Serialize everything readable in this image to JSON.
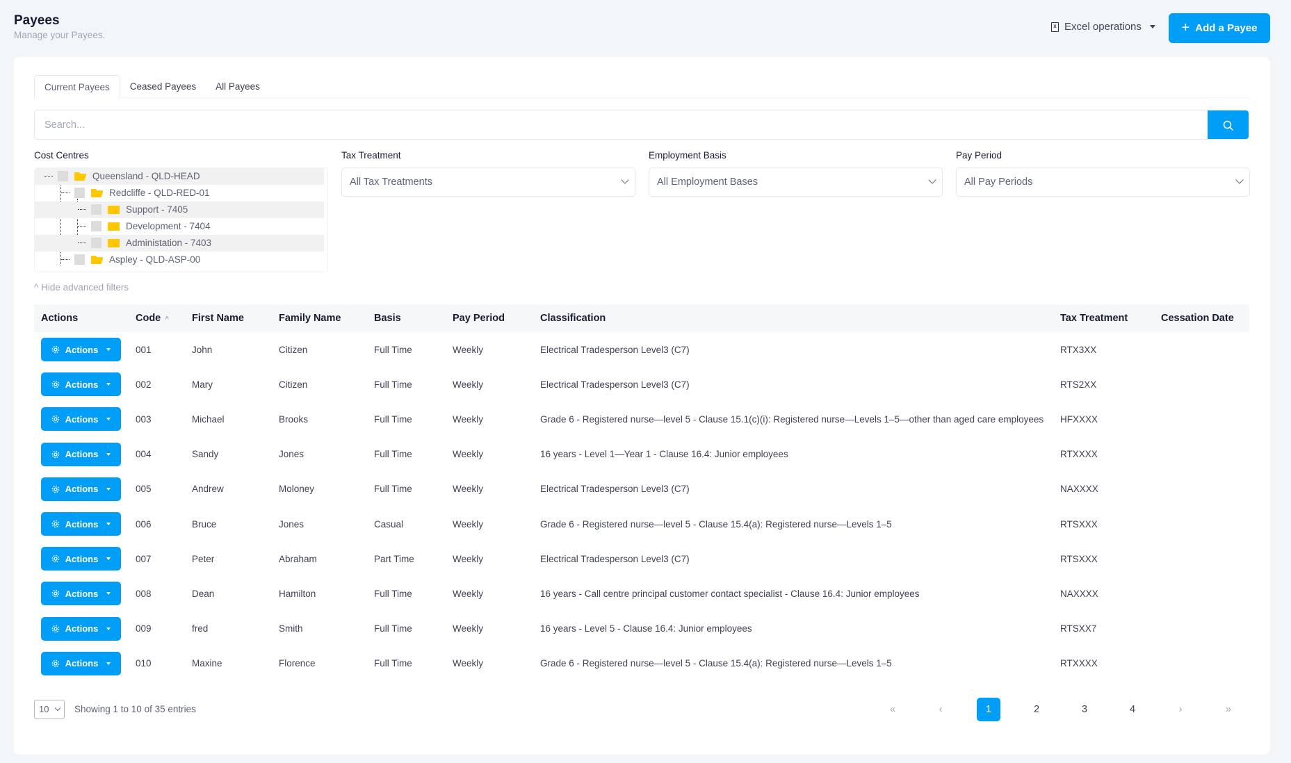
{
  "header": {
    "title": "Payees",
    "subtitle": "Manage your Payees.",
    "excel_label": "Excel operations",
    "add_label": "Add a Payee"
  },
  "tabs": [
    {
      "label": "Current Payees"
    },
    {
      "label": "Ceased Payees"
    },
    {
      "label": "All Payees"
    }
  ],
  "search": {
    "placeholder": "Search...",
    "value": ""
  },
  "filters": {
    "cost_centres_label": "Cost Centres",
    "tax_label": "Tax Treatment",
    "tax_value": "All Tax Treatments",
    "employment_label": "Employment Basis",
    "employment_value": "All Employment Bases",
    "pay_label": "Pay Period",
    "pay_value": "All Pay Periods",
    "hide_label": "Hide advanced filters"
  },
  "tree": [
    {
      "label": "Queensland - QLD-HEAD",
      "level": 0,
      "open": true
    },
    {
      "label": "Redcliffe - QLD-RED-01",
      "level": 1,
      "open": true
    },
    {
      "label": "Support - 7405",
      "level": 2,
      "open": false
    },
    {
      "label": "Development - 7404",
      "level": 2,
      "open": false
    },
    {
      "label": "Administation - 7403",
      "level": 2,
      "open": false
    },
    {
      "label": "Aspley - QLD-ASP-00",
      "level": 1,
      "open": true
    }
  ],
  "table": {
    "headers": [
      "Actions",
      "Code",
      "First Name",
      "Family Name",
      "Basis",
      "Pay Period",
      "Classification",
      "Tax Treatment",
      "Cessation Date"
    ],
    "action_label": "Actions",
    "rows": [
      {
        "code": "001",
        "first": "John",
        "family": "Citizen",
        "basis": "Full Time",
        "period": "Weekly",
        "classification": "Electrical Tradesperson Level3 (C7)",
        "tax": "RTX3XX",
        "cessation": ""
      },
      {
        "code": "002",
        "first": "Mary",
        "family": "Citizen",
        "basis": "Full Time",
        "period": "Weekly",
        "classification": "Electrical Tradesperson Level3 (C7)",
        "tax": "RTS2XX",
        "cessation": ""
      },
      {
        "code": "003",
        "first": "Michael",
        "family": "Brooks",
        "basis": "Full Time",
        "period": "Weekly",
        "classification": "Grade 6 - Registered nurse—level 5 - Clause 15.1(c)(i): Registered nurse—Levels 1–5—other than aged care employees",
        "tax": "HFXXXX",
        "cessation": ""
      },
      {
        "code": "004",
        "first": "Sandy",
        "family": "Jones",
        "basis": "Full Time",
        "period": "Weekly",
        "classification": "16 years - Level 1—Year 1 - Clause 16.4: Junior employees",
        "tax": "RTXXXX",
        "cessation": ""
      },
      {
        "code": "005",
        "first": "Andrew",
        "family": "Moloney",
        "basis": "Full Time",
        "period": "Weekly",
        "classification": "Electrical Tradesperson Level3 (C7)",
        "tax": "NAXXXX",
        "cessation": ""
      },
      {
        "code": "006",
        "first": "Bruce",
        "family": "Jones",
        "basis": "Casual",
        "period": "Weekly",
        "classification": "Grade 6 - Registered nurse—level 5 - Clause 15.4(a): Registered nurse—Levels 1–5",
        "tax": "RTSXXX",
        "cessation": ""
      },
      {
        "code": "007",
        "first": "Peter",
        "family": "Abraham",
        "basis": "Part Time",
        "period": "Weekly",
        "classification": "Electrical Tradesperson Level3 (C7)",
        "tax": "RTSXXX",
        "cessation": ""
      },
      {
        "code": "008",
        "first": "Dean",
        "family": "Hamilton",
        "basis": "Full Time",
        "period": "Weekly",
        "classification": "16 years - Call centre principal customer contact specialist - Clause 16.4: Junior employees",
        "tax": "NAXXXX",
        "cessation": ""
      },
      {
        "code": "009",
        "first": "fred",
        "family": "Smith",
        "basis": "Full Time",
        "period": "Weekly",
        "classification": "16 years - Level 5 - Clause 16.4: Junior employees",
        "tax": "RTSXX7",
        "cessation": ""
      },
      {
        "code": "010",
        "first": "Maxine",
        "family": "Florence",
        "basis": "Full Time",
        "period": "Weekly",
        "classification": "Grade 6 - Registered nurse—level 5 - Clause 15.4(a): Registered nurse—Levels 1–5",
        "tax": "RTXXXX",
        "cessation": ""
      }
    ]
  },
  "pagination": {
    "page_size": "10",
    "showing": "Showing 1 to 10 of 35 entries",
    "first": "«",
    "prev": "‹",
    "next": "›",
    "last": "»",
    "pages": [
      "1",
      "2",
      "3",
      "4"
    ],
    "current": "1"
  },
  "colors": {
    "accent": "#009ef7",
    "folder": "#ffc700"
  }
}
